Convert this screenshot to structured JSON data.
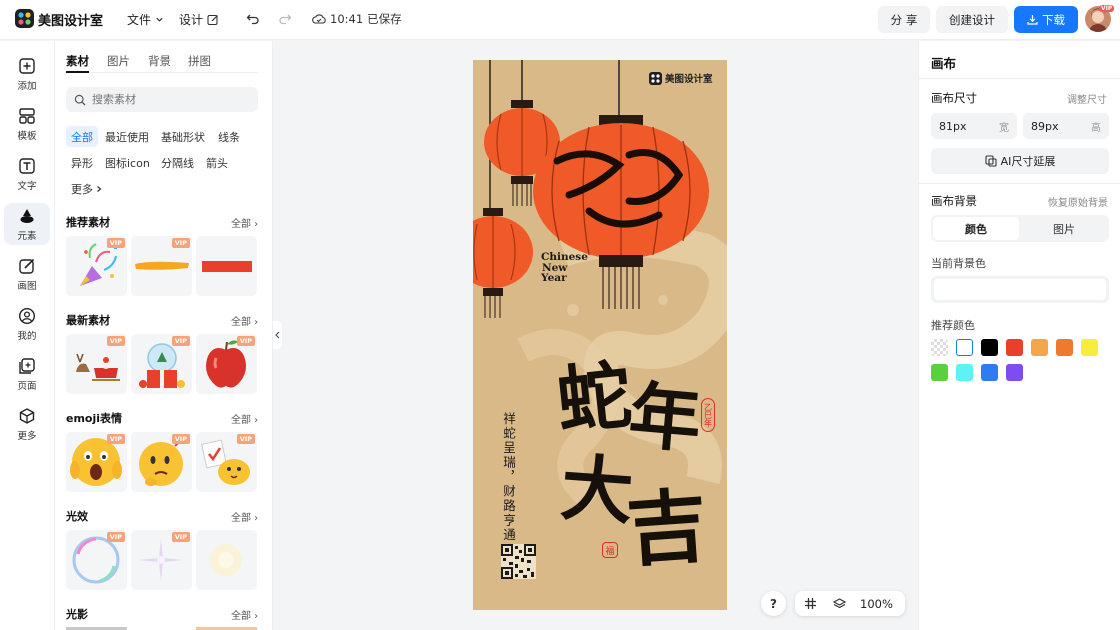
{
  "topbar": {
    "app_name": "美图设计室",
    "menu_file": "文件",
    "menu_design": "设计",
    "save_time": "10:41",
    "save_status": "已保存",
    "share_label": "分 享",
    "create_label": "创建设计",
    "download_label": "下载",
    "avatar_badge": "VIP",
    "download_color": "#1677ff"
  },
  "rail": {
    "items": [
      {
        "label": "添加",
        "icon": "plus-square-icon"
      },
      {
        "label": "模板",
        "icon": "template-grid-icon"
      },
      {
        "label": "文字",
        "icon": "text-icon"
      },
      {
        "label": "元素",
        "icon": "shapes-icon",
        "active": true
      },
      {
        "label": "画图",
        "icon": "draw-pencil-icon"
      },
      {
        "label": "我的",
        "icon": "user-icon"
      },
      {
        "label": "页面",
        "icon": "page-add-icon"
      },
      {
        "label": "更多",
        "icon": "cube-icon"
      }
    ]
  },
  "panel": {
    "tabs": [
      "素材",
      "图片",
      "背景",
      "拼图"
    ],
    "search_placeholder": "搜索素材",
    "chips": [
      "全部",
      "最近使用",
      "基础形状",
      "线条",
      "异形",
      "图标icon",
      "分隔线",
      "箭头",
      "更多"
    ],
    "sections": [
      {
        "title": "推荐素材",
        "all": "全部",
        "thumbs": [
          "party-popper",
          "yellow-brush-stroke",
          "red-rectangle"
        ],
        "vip": [
          true,
          true,
          false
        ]
      },
      {
        "title": "最新素材",
        "all": "全部",
        "thumbs": [
          "reindeer-sleigh",
          "snow-globe-gift",
          "red-apple"
        ],
        "vip": [
          true,
          true,
          true
        ]
      },
      {
        "title": "emoji表情",
        "all": "全部",
        "thumbs": [
          "shocked-emoji",
          "thinking-emoji",
          "vote-emoji"
        ],
        "vip": [
          true,
          true,
          true
        ]
      },
      {
        "title": "光效",
        "all": "全部",
        "thumbs": [
          "bubble-ring",
          "sparkle-star",
          "soft-glow"
        ],
        "vip": [
          true,
          true,
          false
        ]
      },
      {
        "title": "光影",
        "all": "全部"
      }
    ]
  },
  "poster": {
    "brand": "美图设计室",
    "headline_chars": [
      "蛇",
      "年",
      "大",
      "吉"
    ],
    "subtitle_en": [
      "Chinese",
      "New",
      "Year"
    ],
    "seal": "乙巳年",
    "seal2": "福",
    "vertical_line_1": "祥蛇呈瑞",
    "vertical_line_2": "财路亨通",
    "background_color": "#d9b987",
    "lantern_color": "#f05a28"
  },
  "float": {
    "help": "?",
    "zoom": "100%"
  },
  "right": {
    "title": "画布",
    "size_label": "画布尺寸",
    "resize_link": "调整尺寸",
    "width_value": "81px",
    "width_unit": "宽",
    "height_value": "89px",
    "height_unit": "高",
    "ai_extend": "AI尺寸延展",
    "bg_label": "画布背景",
    "bg_reset": "恢复原始背景",
    "bg_tabs": [
      "颜色",
      "图片"
    ],
    "current_bg_label": "当前背景色",
    "rec_colors_label": "推荐颜色",
    "colors": [
      "transparent",
      "#ffffff",
      "#000000",
      "#e8402b",
      "#f5a54a",
      "#ee7a2f",
      "#f7ee3c",
      "#5ad03e",
      "#5ef2f0",
      "#2f7bf0",
      "#7e4df0"
    ]
  }
}
